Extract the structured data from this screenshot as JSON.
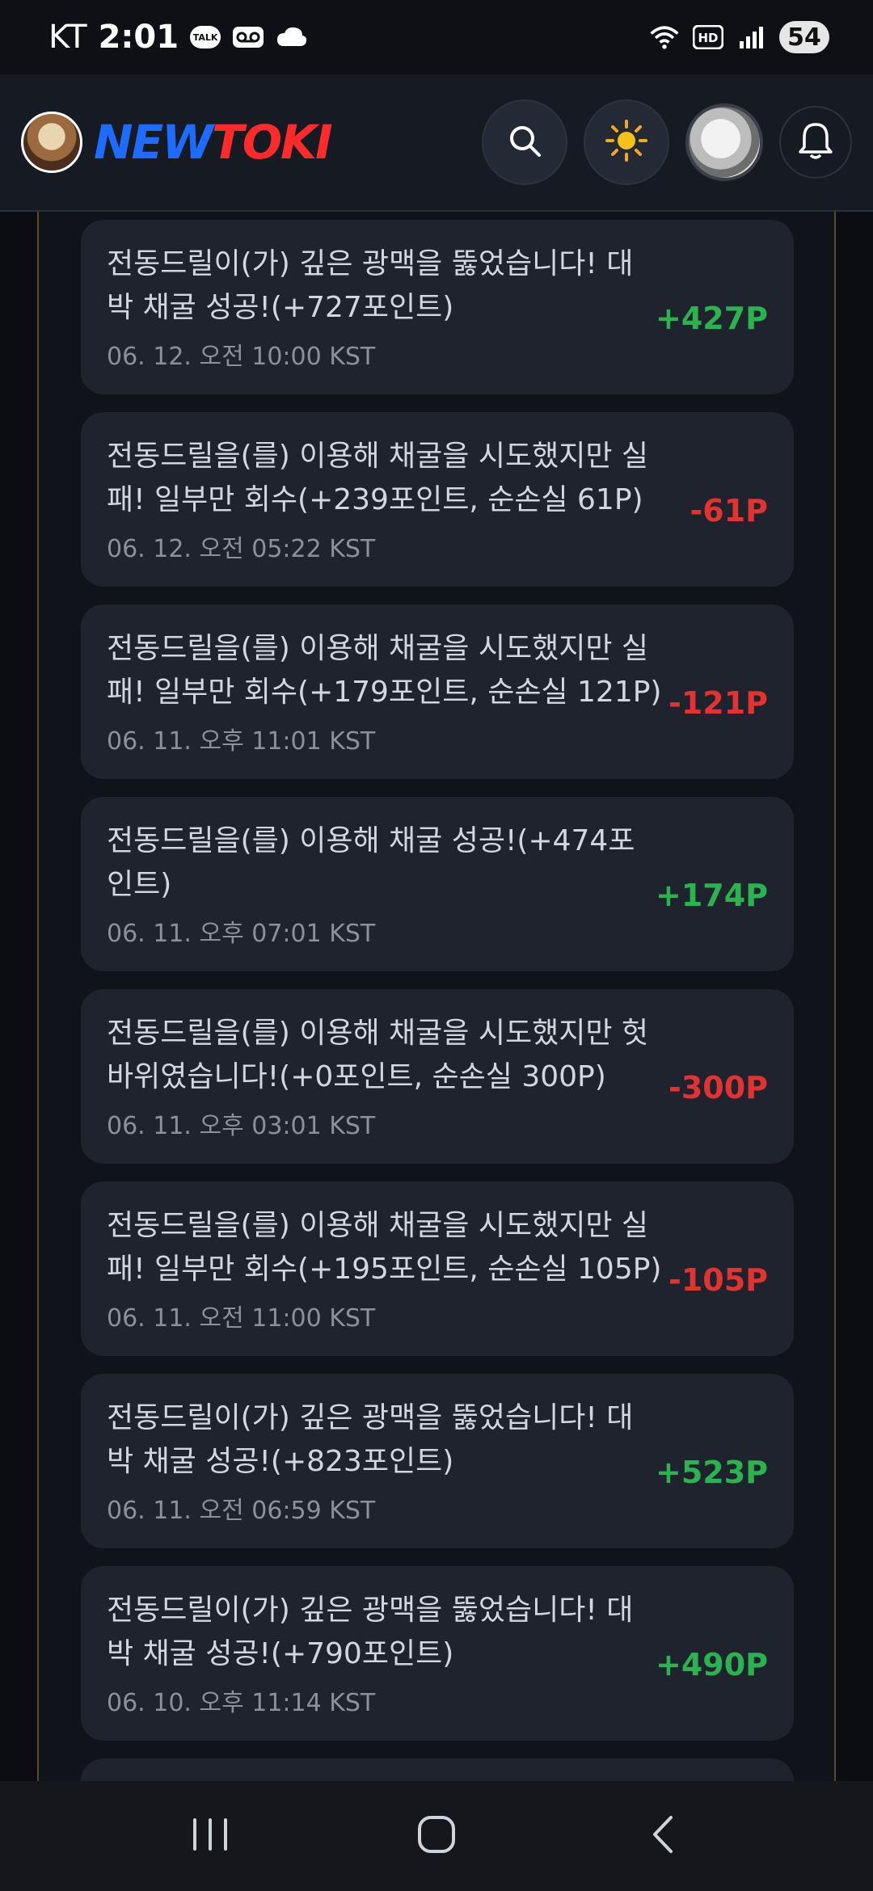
{
  "status_bar": {
    "carrier": "KT",
    "time": "2:01",
    "talk_badge": "TALK",
    "battery": "54"
  },
  "header": {
    "logo_new": "NEW",
    "logo_toki": "TOKI"
  },
  "colors": {
    "positive": "#2bb34f",
    "negative": "#e23232"
  },
  "logs": [
    {
      "message": "전동드릴이(가) 깊은 광맥을 뚫었습니다! 대박 채굴 성공!(+727포인트)",
      "time": "06. 12. 오전 10:00 KST",
      "amount": "+427P",
      "sign": "pos"
    },
    {
      "message": "전동드릴을(를) 이용해 채굴을 시도했지만 실패! 일부만 회수(+239포인트, 순손실 61P)",
      "time": "06. 12. 오전 05:22 KST",
      "amount": "-61P",
      "sign": "neg"
    },
    {
      "message": "전동드릴을(를) 이용해 채굴을 시도했지만 실패! 일부만 회수(+179포인트, 순손실 121P)",
      "time": "06. 11. 오후 11:01 KST",
      "amount": "-121P",
      "sign": "neg"
    },
    {
      "message": "전동드릴을(를) 이용해 채굴 성공!(+474포인트)",
      "time": "06. 11. 오후 07:01 KST",
      "amount": "+174P",
      "sign": "pos"
    },
    {
      "message": "전동드릴을(를) 이용해 채굴을 시도했지만 헛바위였습니다!(+0포인트, 순손실 300P)",
      "time": "06. 11. 오후 03:01 KST",
      "amount": "-300P",
      "sign": "neg"
    },
    {
      "message": "전동드릴을(를) 이용해 채굴을 시도했지만 실패! 일부만 회수(+195포인트, 순손실 105P)",
      "time": "06. 11. 오전 11:00 KST",
      "amount": "-105P",
      "sign": "neg"
    },
    {
      "message": "전동드릴이(가) 깊은 광맥을 뚫었습니다! 대박 채굴 성공!(+823포인트)",
      "time": "06. 11. 오전 06:59 KST",
      "amount": "+523P",
      "sign": "pos"
    },
    {
      "message": "전동드릴이(가) 깊은 광맥을 뚫었습니다! 대박 채굴 성공!(+790포인트)",
      "time": "06. 10. 오후 11:14 KST",
      "amount": "+490P",
      "sign": "pos"
    }
  ],
  "icons": {
    "search": "search-icon",
    "theme": "sun-icon",
    "notifications": "bell-icon",
    "nav_recent": "recent-apps-icon",
    "nav_home": "home-icon",
    "nav_back": "back-icon"
  }
}
